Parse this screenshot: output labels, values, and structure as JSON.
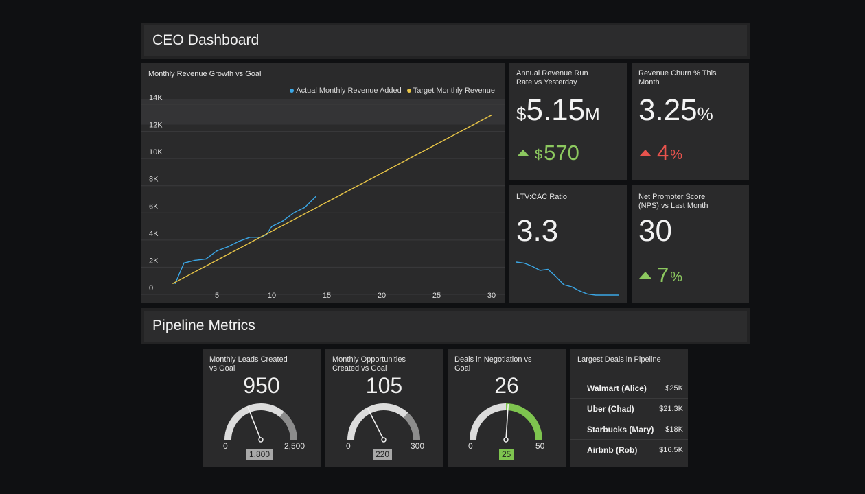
{
  "dashboard": {
    "title": "CEO Dashboard"
  },
  "revenue_chart": {
    "title": "Monthly Revenue Growth vs Goal",
    "legend": [
      "Actual Monthly Revenue Added",
      "Target Monthly Revenue"
    ],
    "y_ticks": [
      "14K",
      "12K",
      "10K",
      "8K",
      "6K",
      "4K",
      "2K",
      "0"
    ],
    "x_ticks": [
      "5",
      "10",
      "15",
      "20",
      "25",
      "30"
    ]
  },
  "chart_data": {
    "type": "line",
    "title": "Monthly Revenue Growth vs Goal",
    "xlabel": "",
    "ylabel": "",
    "xlim": [
      0,
      31
    ],
    "ylim": [
      0,
      14000
    ],
    "grid": true,
    "legend_position": "top-right",
    "series": [
      {
        "name": "Actual Monthly Revenue Added",
        "color": "#3ba7e6",
        "x": [
          1.2,
          2,
          3,
          4,
          5,
          6,
          7,
          8,
          9,
          9.5,
          10,
          11,
          12,
          13,
          14
        ],
        "y": [
          300,
          1800,
          2000,
          2100,
          2700,
          3000,
          3400,
          3700,
          3700,
          3900,
          4500,
          4900,
          5500,
          5900,
          6700
        ]
      },
      {
        "name": "Target Monthly Revenue",
        "color": "#e8c547",
        "x": [
          1,
          30
        ],
        "y": [
          300,
          12700
        ]
      }
    ]
  },
  "arr_tile": {
    "title": "Annual Revenue Run Rate vs Yesterday",
    "currency": "$",
    "value": "5.15",
    "unit": "M",
    "delta_currency": "$",
    "delta_value": "570",
    "delta_color": "#8cc85f"
  },
  "churn_tile": {
    "title": "Revenue Churn % This Month",
    "value": "3.25",
    "unit": "%",
    "delta_value": "4",
    "delta_unit": "%",
    "delta_color": "#e8534d"
  },
  "ltv_tile": {
    "title": "LTV:CAC Ratio",
    "value": "3.3",
    "sparkline": [
      3.3,
      3.25,
      3.1,
      2.9,
      2.95,
      2.6,
      2.2,
      2.1,
      1.9,
      1.75,
      1.7,
      1.7,
      1.7,
      1.7
    ]
  },
  "nps_tile": {
    "title": "Net Promoter Score (NPS) vs Last Month",
    "value": "30",
    "delta_value": "7",
    "delta_unit": "%",
    "delta_color": "#8cc85f"
  },
  "pipeline": {
    "title": "Pipeline Metrics"
  },
  "gauges": [
    {
      "title": "Monthly Leads Created vs Goal",
      "value": "950",
      "min": "0",
      "max": "2,500",
      "goal": "1,800",
      "value_num": 950,
      "goal_num": 1800,
      "max_num": 2500,
      "goal_color": "#a8a8a8",
      "accent": "#8c8c8c"
    },
    {
      "title": "Monthly Opportunities Created vs Goal",
      "value": "105",
      "min": "0",
      "max": "300",
      "goal": "220",
      "value_num": 105,
      "goal_num": 220,
      "max_num": 300,
      "goal_color": "#a8a8a8",
      "accent": "#8c8c8c"
    },
    {
      "title": "Deals in Negotiation vs Goal",
      "value": "26",
      "min": "0",
      "max": "50",
      "goal": "25",
      "value_num": 26,
      "goal_num": 25,
      "max_num": 50,
      "goal_color": "#7ec44f",
      "accent": "#7ec44f"
    }
  ],
  "deals": {
    "title": "Largest Deals in Pipeline",
    "rows": [
      {
        "name": "Walmart (Alice)",
        "value": "$25K"
      },
      {
        "name": "Uber (Chad)",
        "value": "$21.3K"
      },
      {
        "name": "Starbucks (Mary)",
        "value": "$18K"
      },
      {
        "name": "Airbnb (Rob)",
        "value": "$16.5K"
      }
    ]
  }
}
